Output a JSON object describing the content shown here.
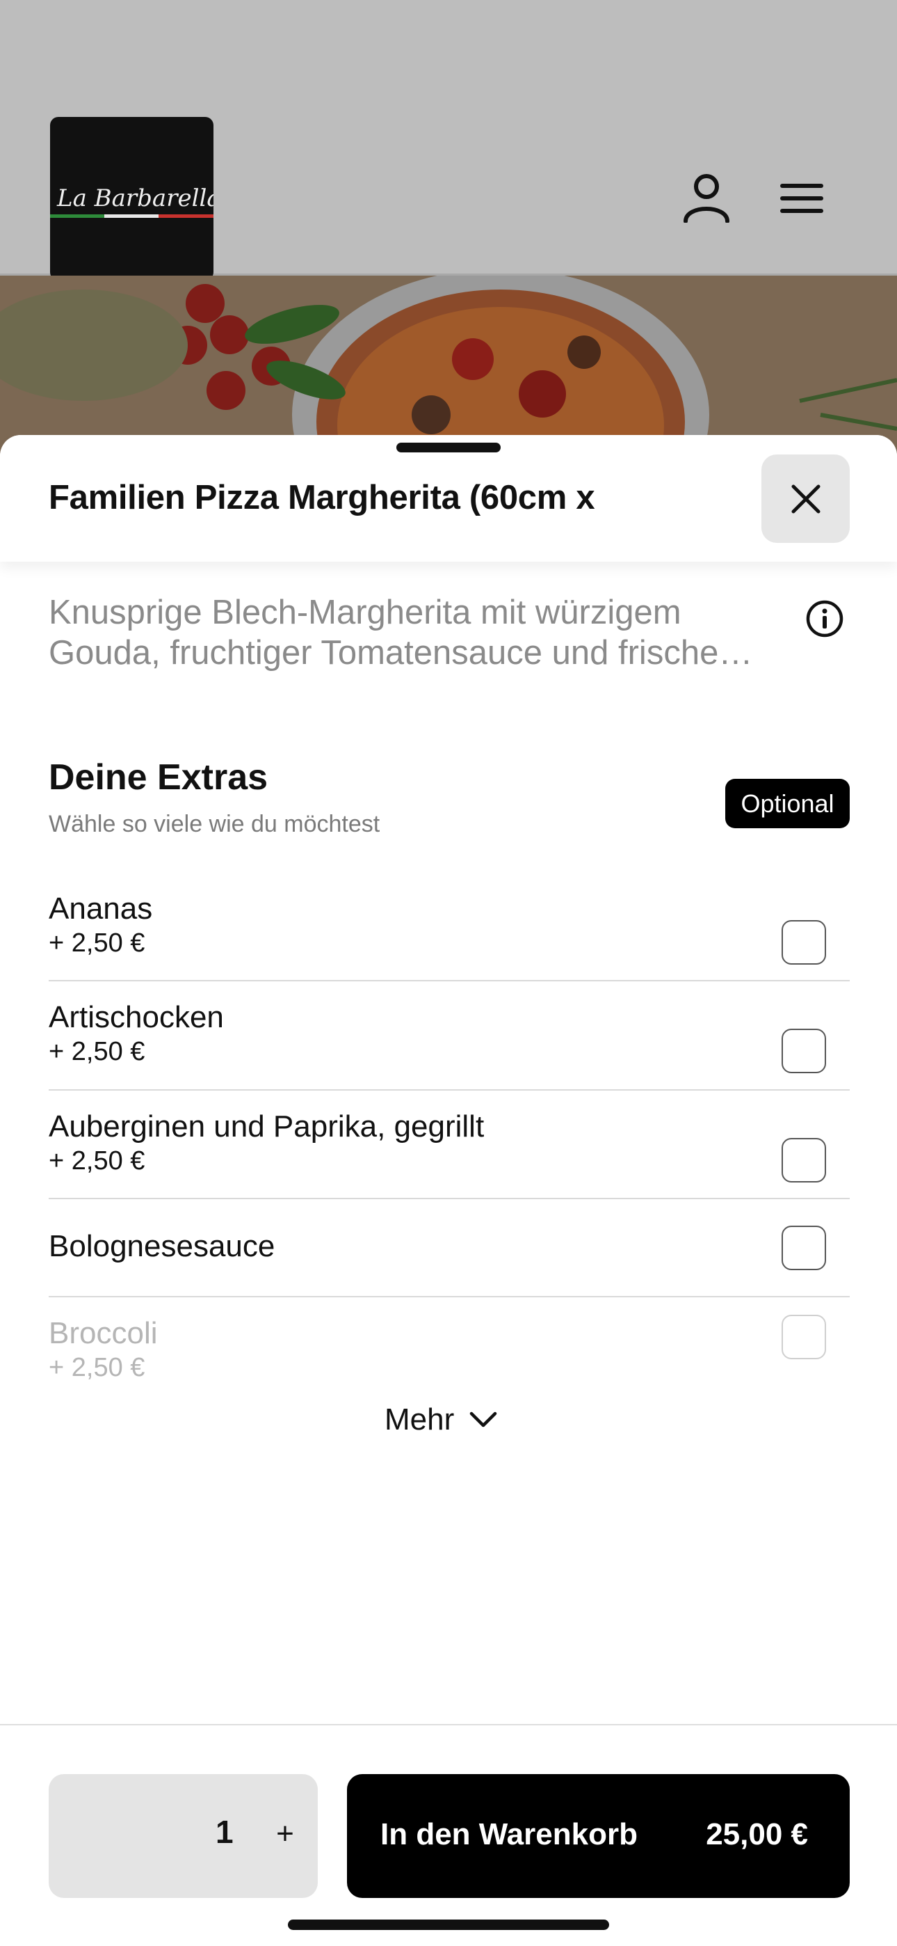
{
  "header": {
    "logo_text": "La Barbarella",
    "icons": [
      "user-icon",
      "menu-icon"
    ]
  },
  "sheet": {
    "title": "Familien Pizza Margherita (60cm x",
    "description_line1": "Knusprige Blech-Margherita mit würzigem",
    "description_line2": "Gouda, fruchtiger Tomatensauce und frische…",
    "info_icon": "info-icon",
    "close_icon": "close-icon"
  },
  "extras": {
    "title": "Deine Extras",
    "subtitle": "Wähle so viele wie du möchtest",
    "badge": "Optional",
    "items": [
      {
        "name": "Ananas",
        "price": "+ 2,50 €",
        "checked": false
      },
      {
        "name": "Artischocken",
        "price": "+ 2,50 €",
        "checked": false
      },
      {
        "name": "Auberginen und Paprika, gegrillt",
        "price": "+ 2,50 €",
        "checked": false
      },
      {
        "name": "Bolognesesauce",
        "price": "",
        "checked": false
      },
      {
        "name": "Broccoli",
        "price": "+ 2,50 €",
        "checked": false
      }
    ],
    "more_label": "Mehr"
  },
  "footer": {
    "quantity": "1",
    "plus_label": "+",
    "cart_label": "In den Warenkorb",
    "cart_price": "25,00 €"
  },
  "colors": {
    "accent": "#000000",
    "header_bg": "#bdbdbd",
    "muted_text": "#8a8a8a"
  }
}
